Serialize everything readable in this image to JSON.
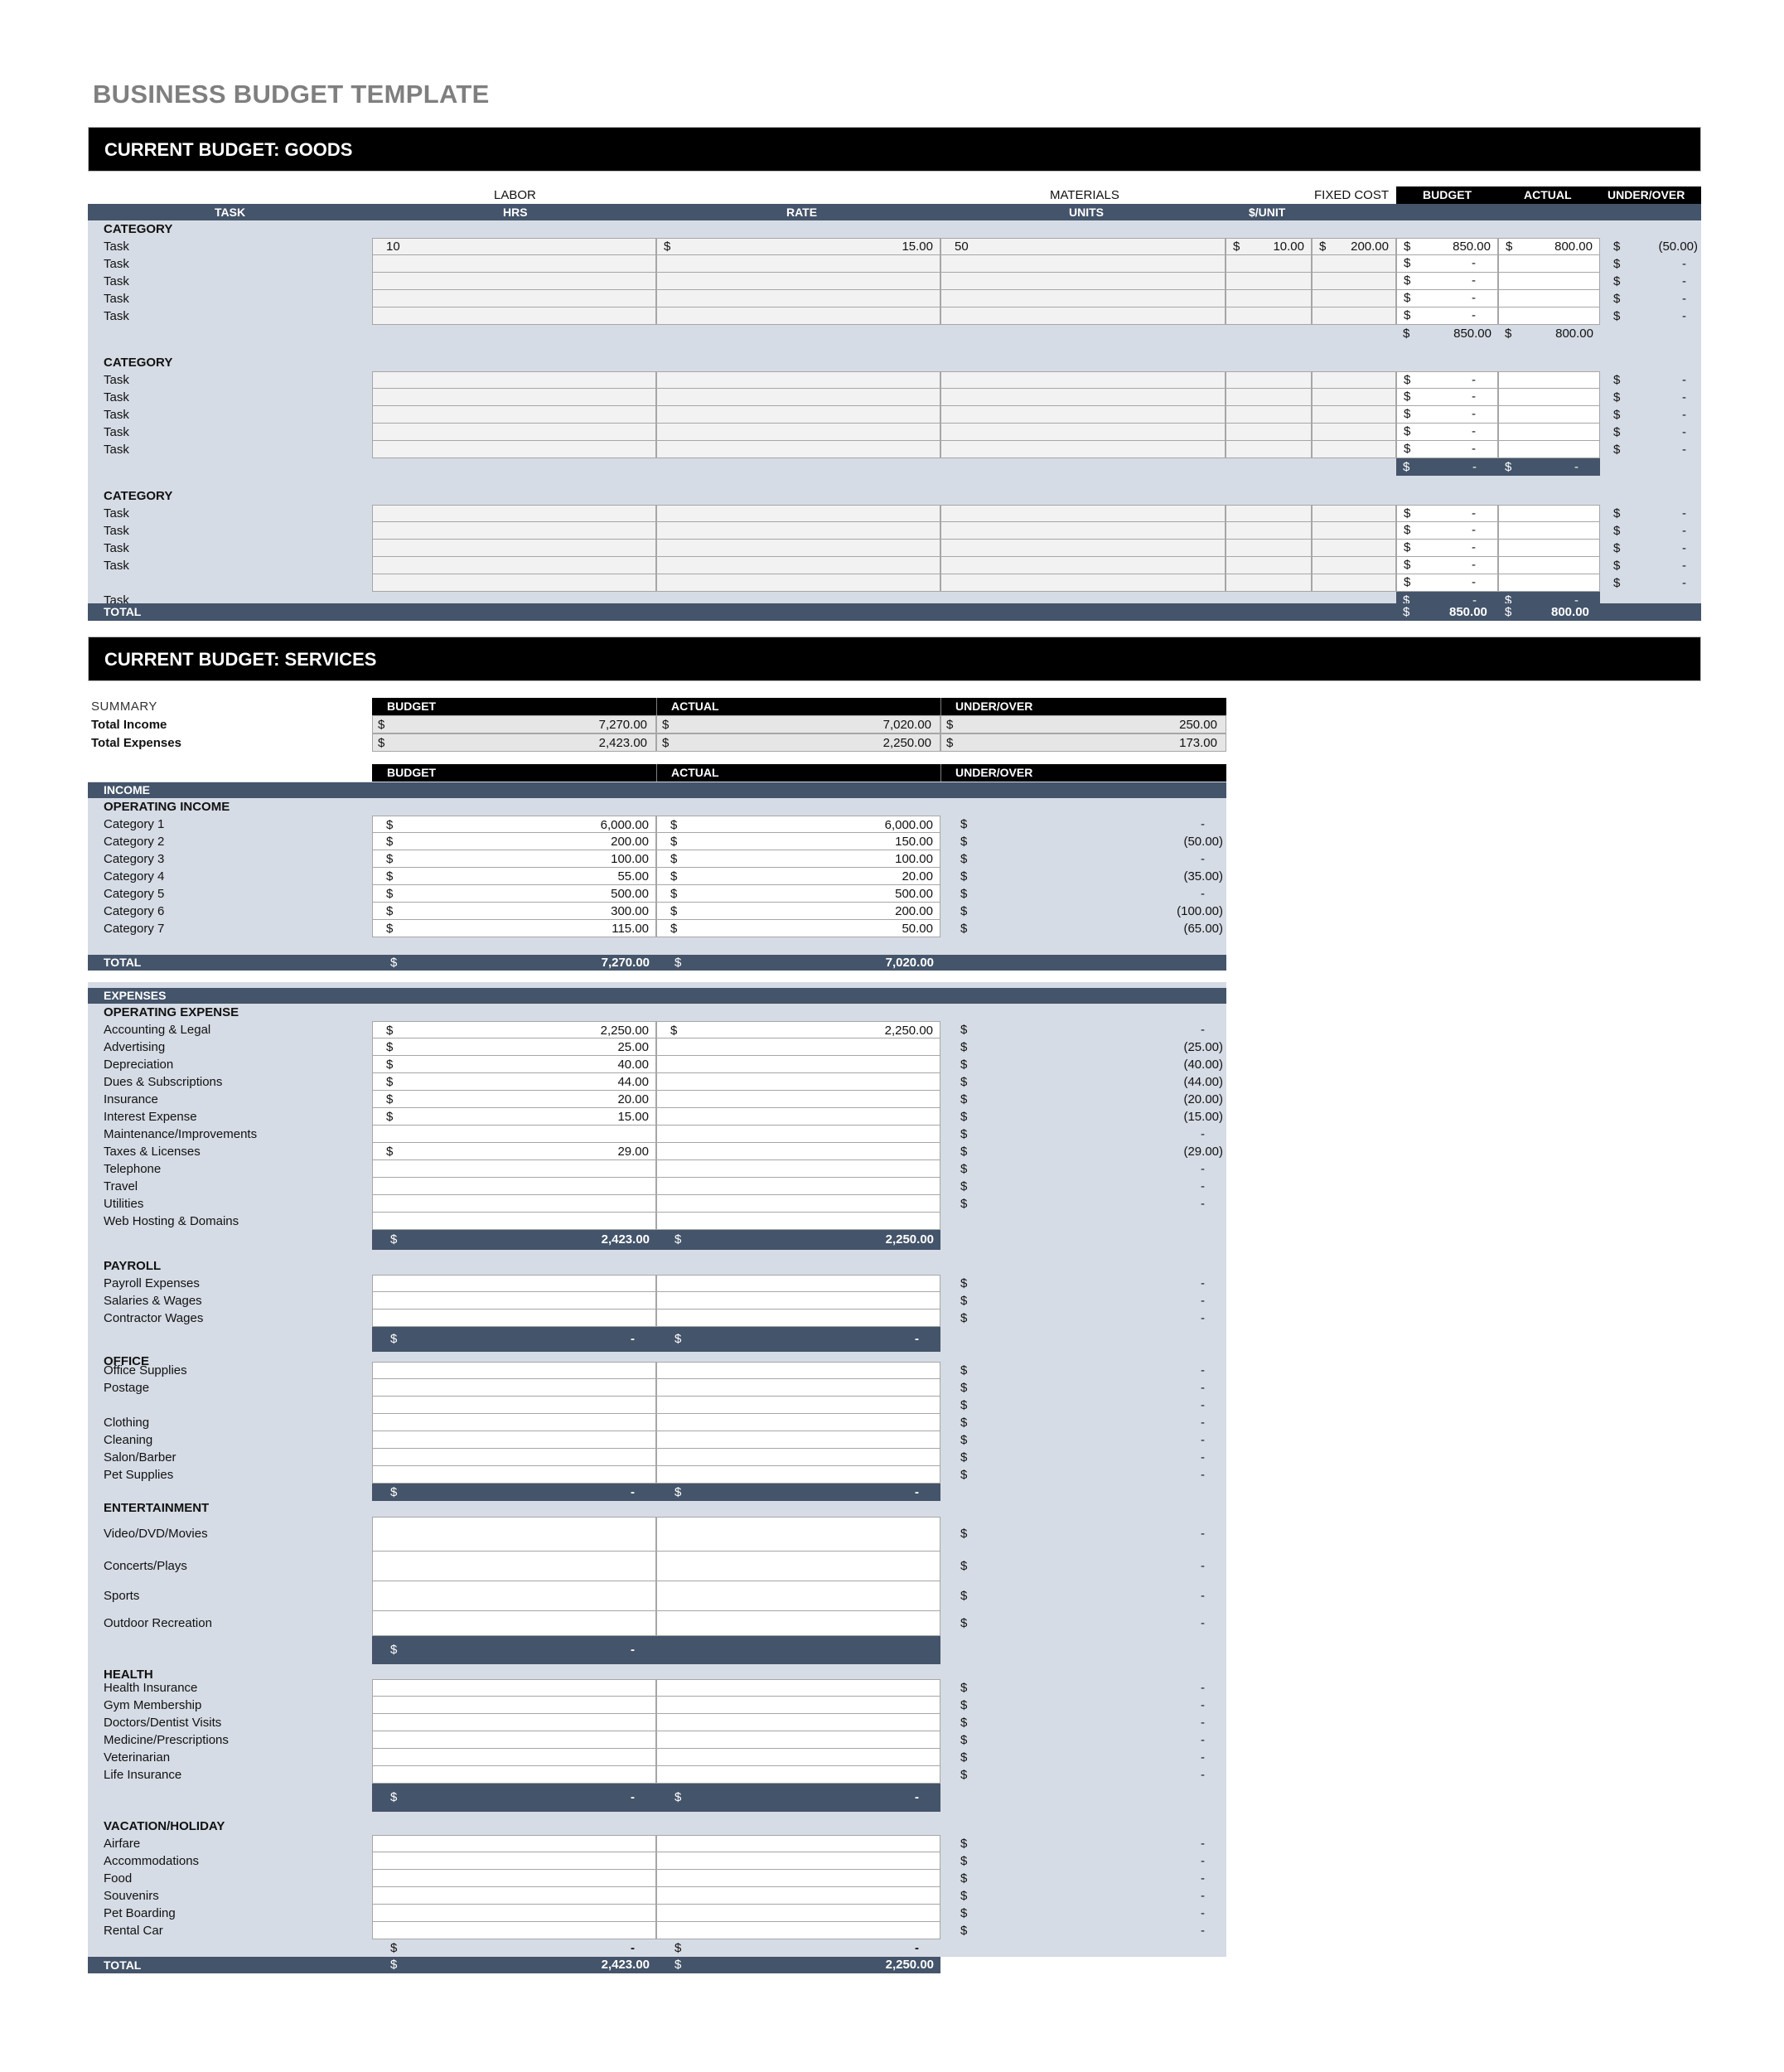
{
  "title": "BUSINESS BUDGET TEMPLATE",
  "goods": {
    "section_title": "CURRENT BUDGET: GOODS",
    "group_labels": {
      "labor": "LABOR",
      "materials": "MATERIALS",
      "fixed_cost": "FIXED COST",
      "budget": "BUDGET",
      "actual": "ACTUAL",
      "under_over": "UNDER/OVER"
    },
    "columns": {
      "task": "TASK",
      "hrs": "HRS",
      "rate": "RATE",
      "units": "UNITS",
      "per_unit": "$/UNIT"
    },
    "currency": "$",
    "dash": "-",
    "categories": [
      {
        "label": "CATEGORY",
        "rows": [
          {
            "task": "Task",
            "hrs": "10",
            "rate": "15.00",
            "units": "50",
            "per_unit": "10.00",
            "fixed": "200.00",
            "budget": "850.00",
            "actual": "800.00",
            "under_over": "(50.00)"
          },
          {
            "task": "Task",
            "hrs": "",
            "rate": "",
            "units": "",
            "per_unit": "",
            "fixed": "",
            "budget": "-",
            "actual": "",
            "under_over": "-"
          },
          {
            "task": "Task",
            "hrs": "",
            "rate": "",
            "units": "",
            "per_unit": "",
            "fixed": "",
            "budget": "-",
            "actual": "",
            "under_over": "-"
          },
          {
            "task": "Task",
            "hrs": "",
            "rate": "",
            "units": "",
            "per_unit": "",
            "fixed": "",
            "budget": "-",
            "actual": "",
            "under_over": "-"
          },
          {
            "task": "Task",
            "hrs": "",
            "rate": "",
            "units": "",
            "per_unit": "",
            "fixed": "",
            "budget": "-",
            "actual": "",
            "under_over": "-"
          }
        ],
        "subtotal": {
          "budget": "850.00",
          "actual": "800.00"
        }
      },
      {
        "label": "CATEGORY",
        "rows": [
          {
            "task": "Task",
            "budget": "-",
            "actual": "",
            "under_over": "-"
          },
          {
            "task": "Task",
            "budget": "-",
            "actual": "",
            "under_over": "-"
          },
          {
            "task": "Task",
            "budget": "-",
            "actual": "",
            "under_over": "-"
          },
          {
            "task": "Task",
            "budget": "-",
            "actual": "",
            "under_over": "-"
          },
          {
            "task": "Task",
            "budget": "-",
            "actual": "",
            "under_over": "-"
          }
        ],
        "subtotal": {
          "budget": "-",
          "actual": "-"
        }
      },
      {
        "label": "CATEGORY",
        "rows": [
          {
            "task": "Task",
            "budget": "-",
            "actual": "",
            "under_over": "-"
          },
          {
            "task": "Task",
            "budget": "-",
            "actual": "",
            "under_over": "-"
          },
          {
            "task": "Task",
            "budget": "-",
            "actual": "",
            "under_over": "-"
          },
          {
            "task": "Task",
            "budget": "-",
            "actual": "",
            "under_over": "-"
          },
          {
            "task": "",
            "budget": "-",
            "actual": "",
            "under_over": "-"
          }
        ],
        "trailing_task": "Task",
        "subtotal": {
          "budget": "-",
          "actual": "-"
        }
      }
    ],
    "total": {
      "label": "TOTAL",
      "budget": "850.00",
      "actual": "800.00"
    }
  },
  "services": {
    "section_title": "CURRENT BUDGET: SERVICES",
    "headers": {
      "budget": "BUDGET",
      "actual": "ACTUAL",
      "under_over": "UNDER/OVER"
    },
    "summary": {
      "label": "SUMMARY",
      "rows": [
        {
          "label": "Total Income",
          "budget": "7,270.00",
          "actual": "7,020.00",
          "under_over": "250.00"
        },
        {
          "label": "Total Expenses",
          "budget": "2,423.00",
          "actual": "2,250.00",
          "under_over": "173.00"
        }
      ]
    },
    "income": {
      "bar_label": "INCOME",
      "group_label": "OPERATING INCOME",
      "rows": [
        {
          "label": "Category 1",
          "budget": "6,000.00",
          "actual": "6,000.00",
          "under_over": "-"
        },
        {
          "label": "Category 2",
          "budget": "200.00",
          "actual": "150.00",
          "under_over": "(50.00)"
        },
        {
          "label": "Category 3",
          "budget": "100.00",
          "actual": "100.00",
          "under_over": "-"
        },
        {
          "label": "Category 4",
          "budget": "55.00",
          "actual": "20.00",
          "under_over": "(35.00)"
        },
        {
          "label": "Category 5",
          "budget": "500.00",
          "actual": "500.00",
          "under_over": "-"
        },
        {
          "label": "Category 6",
          "budget": "300.00",
          "actual": "200.00",
          "under_over": "(100.00)"
        },
        {
          "label": "Category 7",
          "budget": "115.00",
          "actual": "50.00",
          "under_over": "(65.00)"
        }
      ],
      "total": {
        "label": "TOTAL",
        "budget": "7,270.00",
        "actual": "7,020.00"
      }
    },
    "expenses": {
      "bar_label": "EXPENSES",
      "groups": [
        {
          "label": "OPERATING EXPENSE",
          "rows": [
            {
              "label": "Accounting & Legal",
              "budget": "2,250.00",
              "actual": "2,250.00",
              "under_over": "-"
            },
            {
              "label": "Advertising",
              "budget": "25.00",
              "actual": "",
              "under_over": "(25.00)"
            },
            {
              "label": "Depreciation",
              "budget": "40.00",
              "actual": "",
              "under_over": "(40.00)"
            },
            {
              "label": "Dues & Subscriptions",
              "budget": "44.00",
              "actual": "",
              "under_over": "(44.00)"
            },
            {
              "label": "Insurance",
              "budget": "20.00",
              "actual": "",
              "under_over": "(20.00)"
            },
            {
              "label": "Interest Expense",
              "budget": "15.00",
              "actual": "",
              "under_over": "(15.00)"
            },
            {
              "label": "Maintenance/Improvements",
              "budget": "",
              "actual": "",
              "under_over": "-"
            },
            {
              "label": "Taxes & Licenses",
              "budget": "29.00",
              "actual": "",
              "under_over": "(29.00)"
            },
            {
              "label": "Telephone",
              "budget": "",
              "actual": "",
              "under_over": "-"
            },
            {
              "label": "Travel",
              "budget": "",
              "actual": "",
              "under_over": "-"
            },
            {
              "label": "Utilities",
              "budget": "",
              "actual": "",
              "under_over": "-"
            },
            {
              "label": "Web Hosting & Domains",
              "budget": "",
              "actual": "",
              "under_over": null
            }
          ],
          "subtotal": {
            "budget": "2,423.00",
            "actual": "2,250.00"
          }
        },
        {
          "label": "PAYROLL",
          "rows": [
            {
              "label": "Payroll Expenses",
              "under_over": "-"
            },
            {
              "label": "Salaries & Wages",
              "under_over": "-"
            },
            {
              "label": "Contractor Wages",
              "under_over": "-"
            }
          ],
          "subtotal": {
            "budget": "-",
            "actual": "-"
          }
        },
        {
          "label": "OFFICE",
          "rows": [
            {
              "label": "Office Supplies",
              "under_over": "-"
            },
            {
              "label": "Postage",
              "under_over": "-"
            },
            {
              "label": "",
              "under_over": "-"
            },
            {
              "label": "Clothing",
              "under_over": "-"
            },
            {
              "label": "Cleaning",
              "under_over": "-"
            },
            {
              "label": "Salon/Barber",
              "under_over": "-"
            },
            {
              "label": "Pet Supplies",
              "under_over": "-"
            }
          ],
          "subtotal": {
            "budget": "-",
            "actual": "-"
          }
        },
        {
          "label": "ENTERTAINMENT",
          "rows": [
            {
              "label": "Video/DVD/Movies",
              "under_over": "-"
            },
            {
              "label": "Concerts/Plays",
              "under_over": "-"
            },
            {
              "label": "Sports",
              "under_over": "-"
            },
            {
              "label": "Outdoor Recreation",
              "under_over": "-"
            }
          ],
          "subtotal": {
            "budget": "-",
            "actual": null
          }
        },
        {
          "label": "HEALTH",
          "rows": [
            {
              "label": "Health Insurance",
              "under_over": "-"
            },
            {
              "label": "Gym Membership",
              "under_over": "-"
            },
            {
              "label": "Doctors/Dentist Visits",
              "under_over": "-"
            },
            {
              "label": "Medicine/Prescriptions",
              "under_over": "-"
            },
            {
              "label": "Veterinarian",
              "under_over": "-"
            },
            {
              "label": "Life Insurance",
              "under_over": "-"
            }
          ],
          "subtotal": {
            "budget": "-",
            "actual": "-"
          }
        },
        {
          "label": "VACATION/HOLIDAY",
          "rows": [
            {
              "label": "Airfare",
              "under_over": "-"
            },
            {
              "label": "Accommodations",
              "under_over": "-"
            },
            {
              "label": "Food",
              "under_over": "-"
            },
            {
              "label": "Souvenirs",
              "under_over": "-"
            },
            {
              "label": "Pet Boarding",
              "under_over": "-"
            },
            {
              "label": "Rental Car",
              "under_over": "-"
            }
          ],
          "subtotal": {
            "budget": "-",
            "actual": "-"
          }
        }
      ],
      "total": {
        "label": "TOTAL",
        "budget": "2,423.00",
        "actual": "2,250.00"
      }
    }
  },
  "colors": {
    "navy": "#44546a",
    "light": "#d6dce5",
    "input": "#f2f2f2",
    "title_grey": "#7f7f7f"
  }
}
